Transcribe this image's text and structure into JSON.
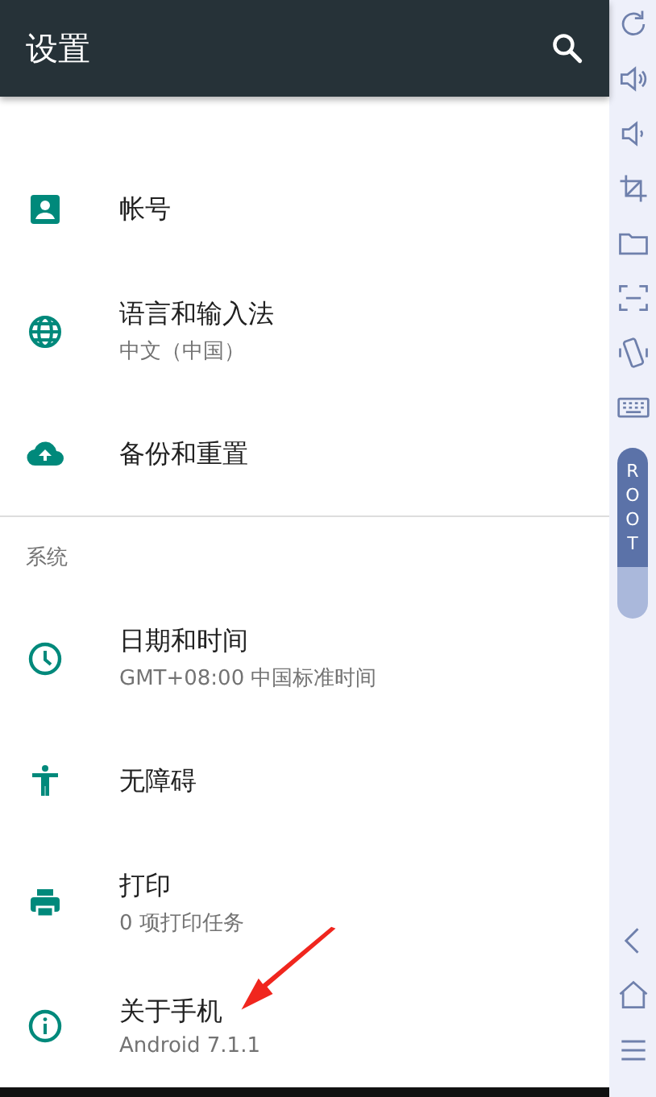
{
  "toolbar": {
    "title": "设置"
  },
  "sections": [
    {
      "items": [
        {
          "title": "帐号"
        },
        {
          "title": "语言和输入法",
          "summary": "中文（中国）"
        },
        {
          "title": "备份和重置"
        }
      ]
    },
    {
      "header": "系统",
      "items": [
        {
          "title": "日期和时间",
          "summary": "GMT+08:00 中国标准时间"
        },
        {
          "title": "无障碍"
        },
        {
          "title": "打印",
          "summary": "0 项打印任务"
        },
        {
          "title": "关于手机",
          "summary": "Android 7.1.1"
        }
      ]
    }
  ],
  "side_panel": {
    "root_label": "ROOT"
  }
}
